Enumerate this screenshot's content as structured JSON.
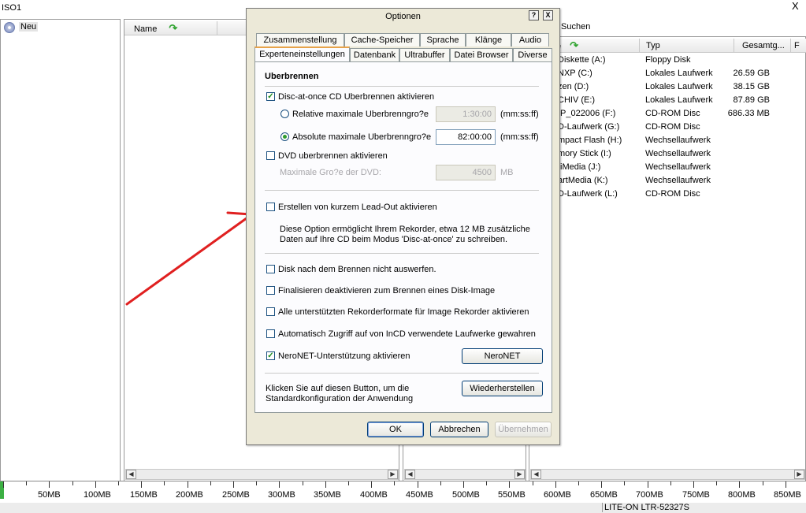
{
  "app": {
    "title": "ISO1",
    "close_glyph": "X",
    "new_item": "Neu",
    "name_column": "Name",
    "search_tab": "Suchen"
  },
  "drives": {
    "columns": [
      "e",
      "Typ",
      "Gesamtg...",
      "F"
    ],
    "rows": [
      {
        "name": "Diskette (A:)",
        "type": "Floppy Disk",
        "size": ""
      },
      {
        "name": "NXP (C:)",
        "type": "Lokales Laufwerk",
        "size": "26.59 GB"
      },
      {
        "name": "zen (D:)",
        "type": "Lokales Laufwerk",
        "size": "38.15 GB"
      },
      {
        "name": "CHIV (E:)",
        "type": "Lokales Laufwerk",
        "size": "87.89 GB"
      },
      {
        "name": "IP_022006 (F:)",
        "type": "CD-ROM Disc",
        "size": "686.33 MB"
      },
      {
        "name": "D-Laufwerk (G:)",
        "type": "CD-ROM Disc",
        "size": ""
      },
      {
        "name": "mpact Flash (H:)",
        "type": "Wechsellaufwerk",
        "size": ""
      },
      {
        "name": "mory Stick (I:)",
        "type": "Wechsellaufwerk",
        "size": ""
      },
      {
        "name": "tiMedia (J:)",
        "type": "Wechsellaufwerk",
        "size": ""
      },
      {
        "name": "artMedia (K:)",
        "type": "Wechsellaufwerk",
        "size": ""
      },
      {
        "name": "D-Laufwerk (L:)",
        "type": "CD-ROM Disc",
        "size": ""
      }
    ]
  },
  "capacity": {
    "labels": [
      "50MB",
      "100MB",
      "150MB",
      "200MB",
      "250MB",
      "300MB",
      "350MB",
      "400MB",
      "450MB",
      "500MB",
      "550MB",
      "600MB",
      "650MB",
      "700MB",
      "750MB",
      "800MB",
      "850MB"
    ]
  },
  "status": {
    "drive": "LITE-ON  LTR-52327S"
  },
  "dialog": {
    "title": "Optionen",
    "help_glyph": "?",
    "close_glyph": "X",
    "tabs_row1": [
      "Zusammenstellung",
      "Cache-Speicher",
      "Sprache",
      "Klänge",
      "Audio"
    ],
    "tabs_row2": [
      "Experteneinstellungen",
      "Datenbank",
      "Ultrabuffer",
      "Datei Browser",
      "Diverse"
    ],
    "section": "Uberbrennen",
    "dao_overburn": "Disc-at-once CD Uberbrennen aktivieren",
    "relative_max": "Relative maximale Uberbrenngro?e",
    "relative_value": "1:30:00",
    "absolute_max": "Absolute maximale Uberbrenngro?e",
    "absolute_value": "82:00:00",
    "time_unit": "(mm:ss:ff)",
    "dvd_overburn": "DVD uberbrennen aktivieren",
    "dvd_max_label": "Maximale Gro?e der DVD:",
    "dvd_max_value": "4500",
    "dvd_unit": "MB",
    "short_leadout": "Erstellen von kurzem Lead-Out aktivieren",
    "leadout_desc_1": "Diese Option ermöglicht Ihrem Rekorder, etwa 12 MB zusätzliche",
    "leadout_desc_2": "Daten auf Ihre CD beim Modus 'Disc-at-once' zu schreiben.",
    "no_eject": "Disk nach dem Brennen nicht auswerfen.",
    "no_finalize": "Finalisieren deaktivieren zum Brennen eines Disk-Image",
    "all_formats": "Alle unterstützten Rekorderformate für Image Rekorder aktivieren",
    "incd_access": "Automatisch Zugriff auf von InCD verwendete Laufwerke gewahren",
    "neronet_support": "NeroNET-Unterstützung aktivieren",
    "neronet_button": "NeroNET",
    "restore_desc_1": "Klicken Sie auf diesen Button, um die",
    "restore_desc_2": "Standardkonfiguration der Anwendung",
    "restore_button": "Wiederherstellen",
    "ok": "OK",
    "cancel": "Abbrechen",
    "apply": "Übernehmen",
    "check_glyph": "✓"
  },
  "colors": {
    "accent_arrow": "#e02020",
    "tab_highlight": "#e7a34a",
    "dialog_bg": "#ece9d8"
  }
}
